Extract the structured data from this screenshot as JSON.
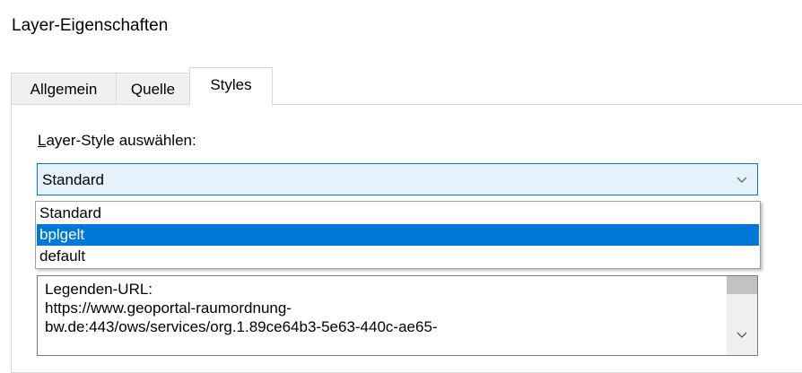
{
  "window": {
    "title": "Layer-Eigenschaften"
  },
  "tabs": [
    {
      "label": "Allgemein",
      "active": false
    },
    {
      "label": "Quelle",
      "active": false
    },
    {
      "label": "Styles",
      "active": true
    }
  ],
  "styles_tab": {
    "layer_style_label_accel": "L",
    "layer_style_label_rest": "ayer-Style auswählen:",
    "selected_value": "Standard",
    "chevron_icon": "chevron-down-icon",
    "options": [
      {
        "label": "Standard",
        "highlighted": false
      },
      {
        "label": "bplgelt",
        "highlighted": true
      },
      {
        "label": "default",
        "highlighted": false
      }
    ],
    "legend_text": "Legenden-URL:\nhttps://www.geoportal-raumordnung-\nbw.de:443/ows/services/org.1.89ce64b3-5e63-440c-ae65-"
  },
  "colors": {
    "accent": "#0078d7",
    "combo_bg": "#e5f1fb",
    "tab_bg": "#f0f0f0"
  }
}
